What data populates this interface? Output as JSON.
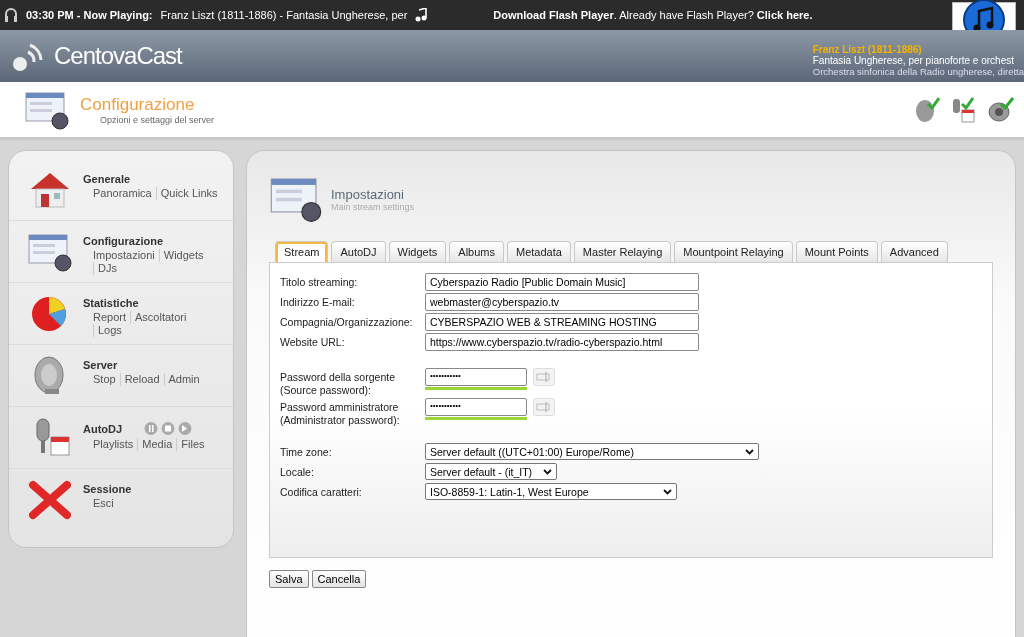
{
  "now_playing": {
    "time": "03:30 PM - Now Playing:",
    "track": "Franz Liszt (1811-1886) - Fantasia Ungherese, per",
    "flash_notice": "**Download Flash Player**. Already have Flash Player? **Click here.**"
  },
  "brand": {
    "name": "CentovaCast"
  },
  "current_track": {
    "artist": "Franz Liszt (1811-1886)",
    "title": "Fantasia Ungherese, per pianoforte e orchest",
    "performer": "Orchestra sinfonica della Radio ungherese, diretta"
  },
  "page_header": {
    "title": "Configurazione",
    "subtitle": "Opzioni e settaggi del server"
  },
  "sidebar": {
    "sections": [
      {
        "kind": "home",
        "title": "Generale",
        "links": [
          "Panoramica",
          "Quick Links"
        ]
      },
      {
        "kind": "config",
        "title": "Configurazione",
        "links": [
          "Impostazioni",
          "Widgets",
          "DJs"
        ]
      },
      {
        "kind": "stats",
        "title": "Statistiche",
        "links": [
          "Report",
          "Ascoltatori",
          "Logs"
        ]
      },
      {
        "kind": "server",
        "title": "Server",
        "links": [
          "Stop",
          "Reload",
          "Admin"
        ]
      },
      {
        "kind": "autodj",
        "title": "AutoDJ",
        "links": [
          "Playlists",
          "Media",
          "Files"
        ]
      },
      {
        "kind": "session",
        "title": "Sessione",
        "links": [
          "Esci"
        ]
      }
    ]
  },
  "panel": {
    "title": "Impostazioni",
    "subtitle": "Main stream settings"
  },
  "tabs": [
    {
      "label": "Stream",
      "selected": true
    },
    {
      "label": "AutoDJ",
      "selected": false
    },
    {
      "label": "Widgets",
      "selected": false
    },
    {
      "label": "Albums",
      "selected": false
    },
    {
      "label": "Metadata",
      "selected": false
    },
    {
      "label": "Master Relaying",
      "selected": false
    },
    {
      "label": "Mountpoint Relaying",
      "selected": false
    },
    {
      "label": "Mount Points",
      "selected": false
    },
    {
      "label": "Advanced",
      "selected": false
    }
  ],
  "form": [
    {
      "kind": "text",
      "label": "Titolo streaming:",
      "value": "Cyberspazio Radio [Public Domain Music]"
    },
    {
      "kind": "text",
      "label": "Indirizzo E-mail:",
      "value": "webmaster@cyberspazio.tv"
    },
    {
      "kind": "text",
      "label": "Compagnia/Organizzazione:",
      "value": "CYBERSPAZIO WEB & STREAMING HOSTING"
    },
    {
      "kind": "text",
      "label": "Website URL:",
      "value": "https://www.cyberspazio.tv/radio-cyberspazio.html"
    },
    {
      "kind": "gap"
    },
    {
      "kind": "password",
      "label": "Password della sorgente (Source password):",
      "value": "•••••••••••",
      "level": 1
    },
    {
      "kind": "password",
      "label": "Password amministratore (Administrator password):",
      "value": "•••••••••••",
      "level": 1
    },
    {
      "kind": "gap"
    },
    {
      "kind": "select",
      "label": "Time zone:",
      "value": "Server default ((UTC+01:00) Europe/Rome)"
    },
    {
      "kind": "select",
      "label": "Locale:",
      "value": "Server default - (it_IT)"
    },
    {
      "kind": "select",
      "label": "Codifica caratteri:",
      "value": "ISO-8859-1: Latin-1, West Europe"
    }
  ],
  "buttons": [
    "Salva",
    "Cancella"
  ]
}
